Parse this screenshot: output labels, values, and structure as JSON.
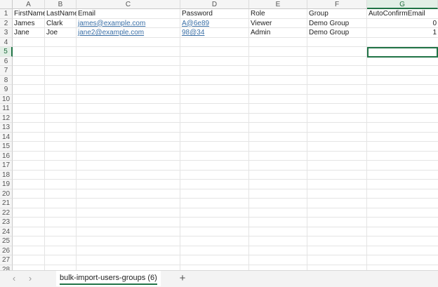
{
  "columns": [
    "A",
    "B",
    "C",
    "D",
    "E",
    "F",
    "G"
  ],
  "selected_column": "G",
  "row_numbers": [
    "1",
    "2",
    "3",
    "4",
    "5",
    "6",
    "7",
    "8",
    "9",
    "10",
    "11",
    "12",
    "13",
    "14",
    "15",
    "16",
    "17",
    "18",
    "19",
    "20",
    "21",
    "22",
    "23",
    "24",
    "25",
    "26",
    "27",
    "28"
  ],
  "selected_row": "5",
  "rows": [
    [
      "FirstName",
      "LastName",
      "Email",
      "Password",
      "Role",
      "Group",
      "AutoConfirmEmail"
    ],
    [
      "James",
      "Clark",
      "james@example.com",
      "A@6e89",
      "Viewer",
      "Demo Group",
      "0"
    ],
    [
      "Jane",
      "Joe",
      "jane2@example.com",
      "98@34",
      "Admin",
      "Demo Group",
      "1"
    ]
  ],
  "tabs": {
    "prev_icon": "chevron-left-icon",
    "next_icon": "chevron-right-icon",
    "sheet_name": "bulk-import-users-groups (6)",
    "add_icon": "+"
  },
  "colors": {
    "accent": "#217346",
    "link": "#3a6fa6"
  }
}
